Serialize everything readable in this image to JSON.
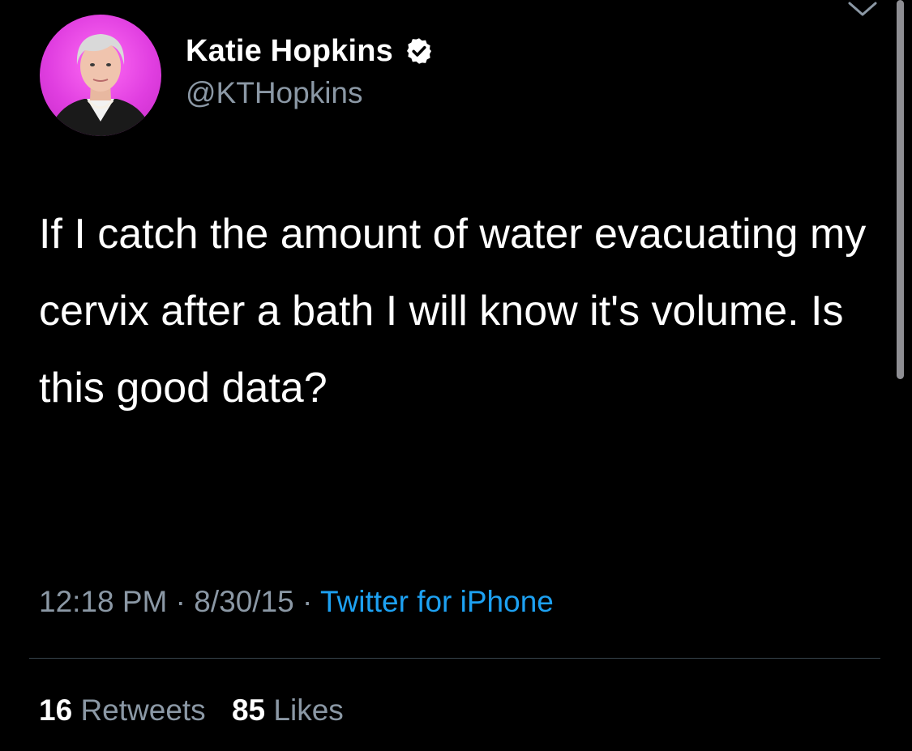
{
  "author": {
    "display_name": "Katie Hopkins",
    "handle": "@KTHopkins",
    "verified": true,
    "avatar_icon": "profile-photo",
    "avatar_bg_color": "#e03ee0"
  },
  "tweet": {
    "text": "If I catch the amount of water evacuating my cervix after a bath I will know it's volume. Is this good data?",
    "time": "12:18 PM",
    "separator": "·",
    "date": "8/30/15",
    "source": "Twitter for iPhone"
  },
  "stats": {
    "retweets_count": "16",
    "retweets_label": "Retweets",
    "likes_count": "85",
    "likes_label": "Likes"
  },
  "colors": {
    "background": "#000000",
    "text": "#ffffff",
    "secondary_text": "#8b98a5",
    "link": "#1da1f2"
  }
}
